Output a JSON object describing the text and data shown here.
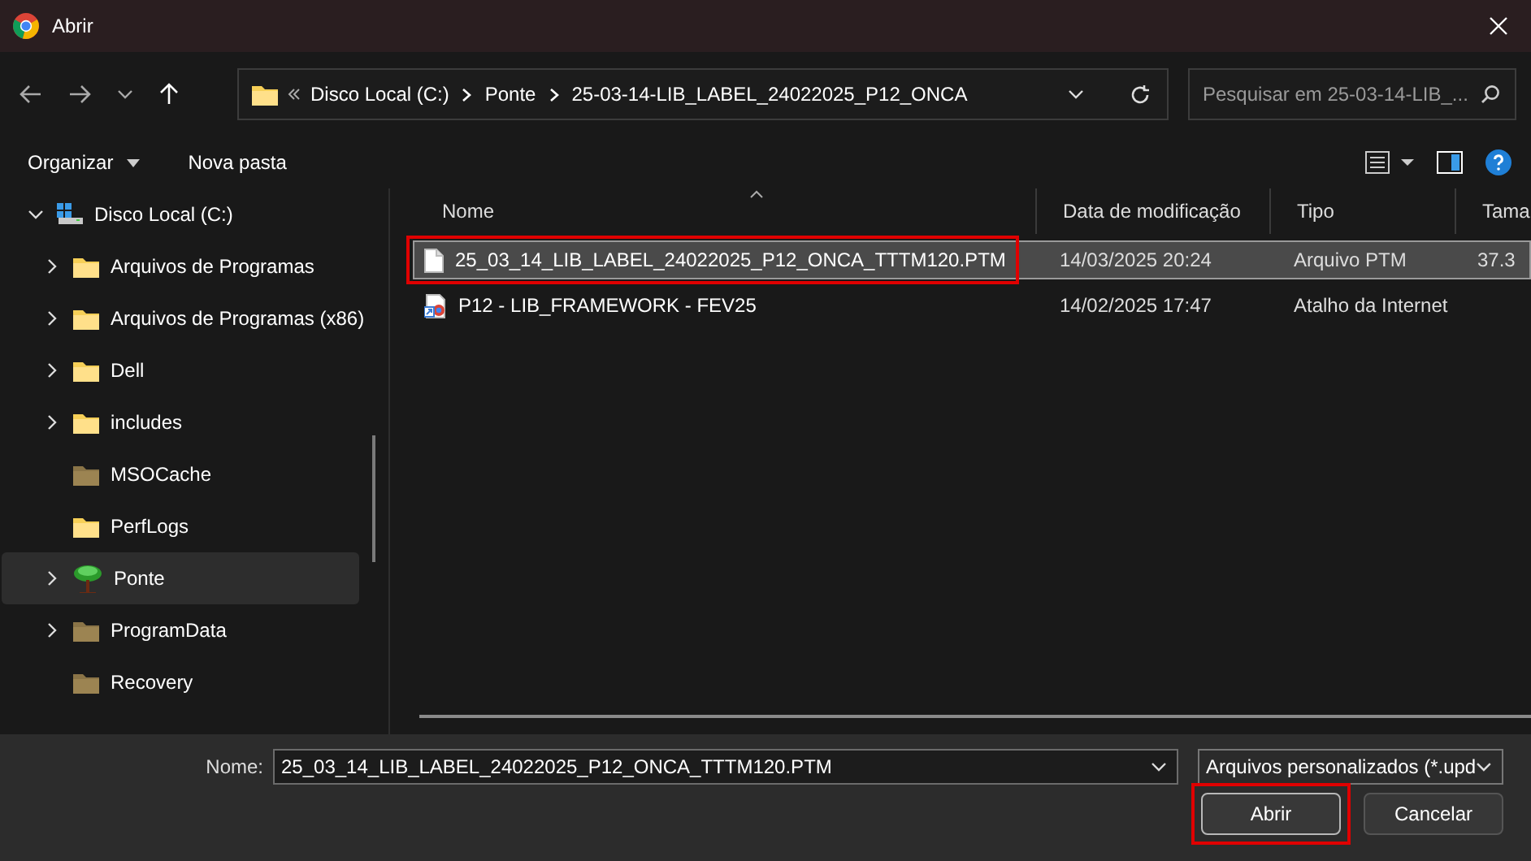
{
  "window": {
    "title": "Abrir"
  },
  "address_bar": {
    "path": [
      {
        "label": "Disco Local (C:)"
      },
      {
        "label": "Ponte"
      },
      {
        "label": "25-03-14-LIB_LABEL_24022025_P12_ONCA"
      }
    ]
  },
  "search": {
    "placeholder": "Pesquisar em 25-03-14-LIB_..."
  },
  "toolbar": {
    "organize": "Organizar",
    "new_folder": "Nova pasta"
  },
  "sidebar": {
    "items": [
      {
        "label": "Disco Local (C:)",
        "kind": "drive",
        "expandable": true,
        "expanded": true,
        "selected": false,
        "children": [
          {
            "label": "Arquivos de Programas",
            "kind": "folder",
            "expandable": true,
            "expanded": false,
            "hidden": false,
            "selected": false
          },
          {
            "label": "Arquivos de Programas (x86)",
            "kind": "folder",
            "expandable": true,
            "expanded": false,
            "hidden": false,
            "selected": false
          },
          {
            "label": "Dell",
            "kind": "folder",
            "expandable": true,
            "expanded": false,
            "hidden": false,
            "selected": false
          },
          {
            "label": "includes",
            "kind": "folder",
            "expandable": true,
            "expanded": false,
            "hidden": false,
            "selected": false
          },
          {
            "label": "MSOCache",
            "kind": "folder",
            "expandable": false,
            "hidden": true,
            "selected": false
          },
          {
            "label": "PerfLogs",
            "kind": "folder",
            "expandable": false,
            "hidden": false,
            "selected": false
          },
          {
            "label": "Ponte",
            "kind": "tree",
            "expandable": true,
            "expanded": false,
            "selected": true
          },
          {
            "label": "ProgramData",
            "kind": "folder",
            "expandable": true,
            "expanded": false,
            "hidden": true,
            "selected": false
          },
          {
            "label": "Recovery",
            "kind": "folder",
            "expandable": false,
            "hidden": true,
            "selected": false
          }
        ]
      }
    ]
  },
  "file_list": {
    "columns": [
      {
        "label": "Nome",
        "sorted": true
      },
      {
        "label": "Data de modificação",
        "sorted": false
      },
      {
        "label": "Tipo",
        "sorted": false
      },
      {
        "label": "Tama",
        "sorted": false
      }
    ],
    "rows": [
      {
        "name": "25_03_14_LIB_LABEL_24022025_P12_ONCA_TTTM120.PTM",
        "date": "14/03/2025 20:24",
        "type": "Arquivo PTM",
        "size": "37.3",
        "kind": "document",
        "selected": true,
        "highlighted": true
      },
      {
        "name": "P12 - LIB_FRAMEWORK - FEV25",
        "date": "14/02/2025 17:47",
        "type": "Atalho da Internet",
        "kind": "shortcut",
        "selected": false,
        "highlighted": false
      }
    ]
  },
  "footer": {
    "name_label": "Nome:",
    "name_value": "25_03_14_LIB_LABEL_24022025_P12_ONCA_TTTM120.PTM",
    "filter": "Arquivos personalizados (*.upd",
    "buttons": [
      {
        "label": "Abrir",
        "kind": "primary",
        "highlighted": true
      },
      {
        "label": "Cancelar",
        "kind": "secondary",
        "highlighted": false
      }
    ]
  }
}
